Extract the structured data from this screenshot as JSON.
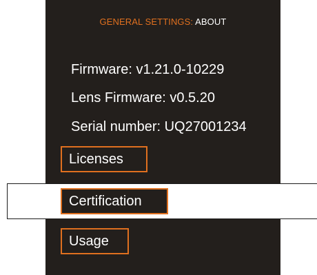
{
  "header": {
    "section": "GENERAL SETTINGS:",
    "page": "ABOUT"
  },
  "info": {
    "firmware": "Firmware: v1.21.0-10229",
    "lens_firmware": "Lens Firmware: v0.5.20",
    "serial_number": "Serial number: UQ27001234"
  },
  "menu": {
    "licenses": "Licenses",
    "certification": "Certification",
    "usage": "Usage"
  },
  "colors": {
    "background": "#231f1c",
    "accent": "#e0701f",
    "text": "#ffffff",
    "selection_background": "#ffffff"
  },
  "state": {
    "selected_item": "Certification"
  }
}
